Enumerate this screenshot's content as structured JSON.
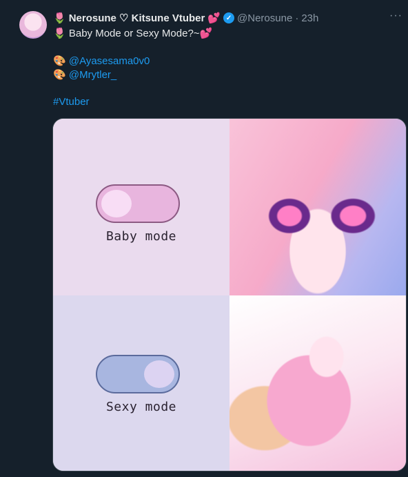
{
  "author": {
    "name": "Nerosune ♡ Kitsune Vtuber",
    "name_prefix_emoji": "🌷",
    "name_suffix_emoji": "💕",
    "handle": "@Nerosune",
    "separator": "·",
    "time": "23h"
  },
  "more_label": "···",
  "verified_glyph": "✓",
  "tweet": {
    "line1_emoji": "🌷",
    "line1_text": "Baby Mode or Sexy Mode?~",
    "line1_suffix_emoji": "💕",
    "credit_emoji": "🎨",
    "mentions": [
      "@Ayasesama0v0",
      "@Mrytler_"
    ],
    "hashtag": "#Vtuber"
  },
  "media": {
    "baby_label": "Baby mode",
    "sexy_label": "Sexy mode"
  },
  "colors": {
    "background": "#15202b",
    "link": "#1d9bf0",
    "baby_panel": "#eadbee",
    "sexy_panel": "#dcd8ee"
  },
  "icons": [
    "verified-badge-icon",
    "more-options-icon",
    "tulip-emoji",
    "heart-emoji",
    "palette-emoji"
  ]
}
